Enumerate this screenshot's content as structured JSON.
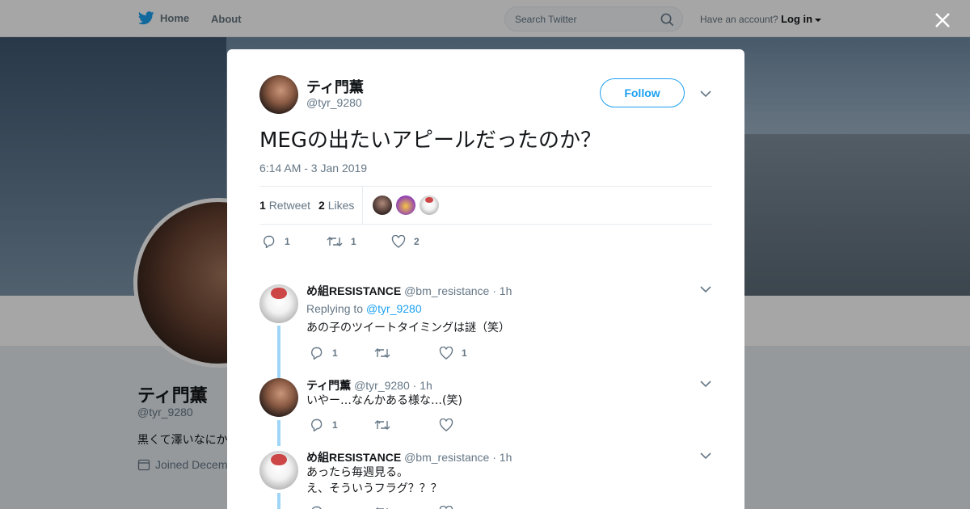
{
  "nav": {
    "home_label": "Home",
    "about_label": "About"
  },
  "search": {
    "placeholder": "Search Twitter"
  },
  "account": {
    "prompt": "Have an account?",
    "login_label": "Log in"
  },
  "profile": {
    "name": "ティ門薫",
    "handle": "@tyr_9280",
    "bio_partial": "黒くて澤いなにか",
    "joined_partial": "Joined Decem"
  },
  "tweet": {
    "author_name": "ティ門薫",
    "author_handle": "@tyr_9280",
    "follow_label": "Follow",
    "text": "MEGの出たいアピールだったのか？",
    "timestamp": "6:14 AM - 3 Jan 2019",
    "retweet_count": "1",
    "retweet_label": "Retweet",
    "like_count": "2",
    "like_label": "Likes",
    "action_reply_count": "1",
    "action_retweet_count": "1",
    "action_like_count": "2"
  },
  "replies": [
    {
      "name": "め組RESISTANCE",
      "handle": "@bm_resistance",
      "time": "· 1h",
      "replying_prefix": "Replying to",
      "replying_to": "@tyr_9280",
      "lines": [
        "あの子のツイートタイミングは謎（笑）"
      ],
      "reply_count": "1",
      "retweet_count": "",
      "like_count": "1"
    },
    {
      "name": "ティ門薫",
      "handle": "@tyr_9280",
      "time": "· 1h",
      "lines": [
        "いやー…なんかある様な…(笑)"
      ],
      "reply_count": "1",
      "retweet_count": "",
      "like_count": ""
    },
    {
      "name": "め組RESISTANCE",
      "handle": "@bm_resistance",
      "time": "· 1h",
      "lines": [
        "あったら毎週見る。",
        "え、そういうフラグ？？？"
      ],
      "reply_count": "",
      "retweet_count": "",
      "like_count": ""
    }
  ],
  "colors": {
    "accent": "#1da1f2",
    "muted": "#657786",
    "thread": "#9fd6f7"
  },
  "icons": [
    "twitter-bird-icon",
    "search-icon",
    "caret-down-icon",
    "close-icon",
    "chevron-down-icon",
    "reply-icon",
    "retweet-icon",
    "like-icon",
    "calendar-icon"
  ]
}
